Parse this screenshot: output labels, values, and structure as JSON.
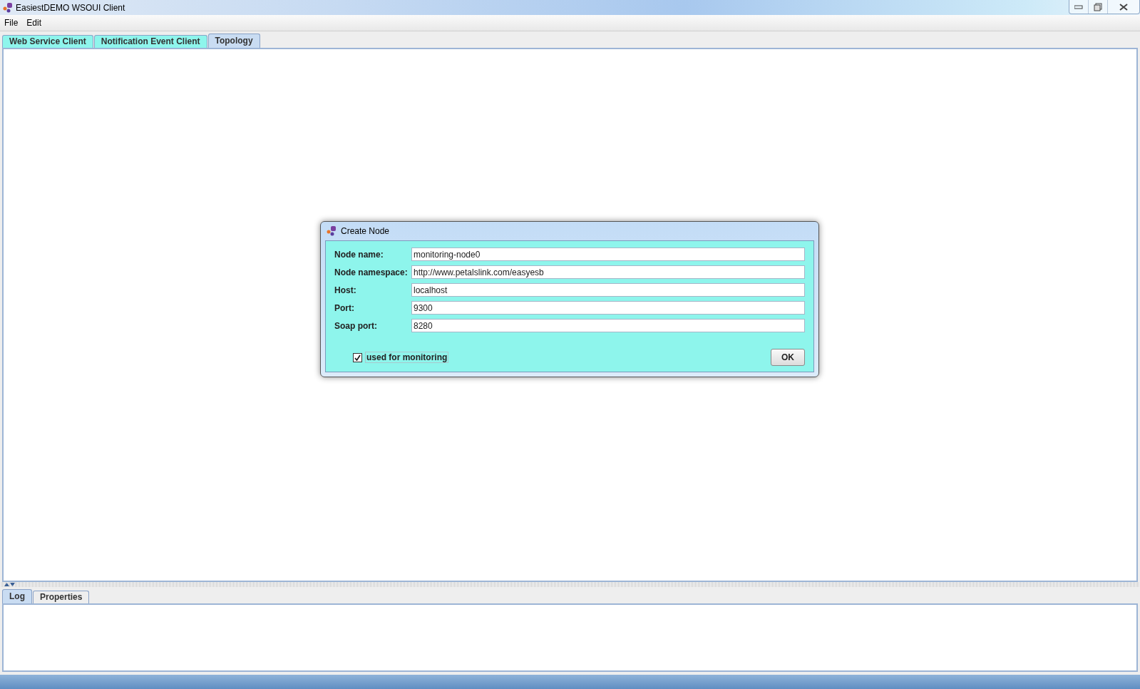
{
  "window": {
    "title": "EasiestDEMO WSOUI Client"
  },
  "menu": [
    "File",
    "Edit"
  ],
  "tabs": [
    {
      "label": "Web Service Client",
      "selected": false
    },
    {
      "label": "Notification Event Client",
      "selected": false
    },
    {
      "label": "Topology",
      "selected": true
    }
  ],
  "dialog": {
    "title": "Create Node",
    "fields": [
      {
        "label": "Node name:",
        "value": "monitoring-node0"
      },
      {
        "label": "Node namespace:",
        "value": "http://www.petalslink.com/easyesb"
      },
      {
        "label": "Host:",
        "value": "localhost"
      },
      {
        "label": "Port:",
        "value": "9300"
      },
      {
        "label": "Soap port:",
        "value": "8280"
      }
    ],
    "checkbox": {
      "label": "used for monitoring",
      "checked": true
    },
    "ok_button": "OK"
  },
  "bottom_tabs": [
    {
      "label": "Log",
      "selected": true
    },
    {
      "label": "Properties",
      "selected": false
    }
  ]
}
